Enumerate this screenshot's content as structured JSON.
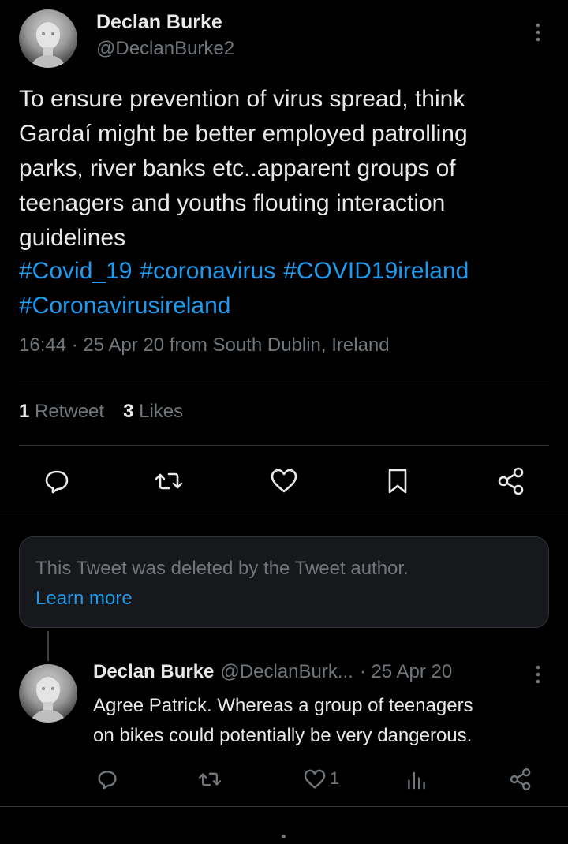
{
  "tweet": {
    "author_name": "Declan Burke",
    "author_handle": "@DeclanBurke2",
    "body_lines": [
      "To ensure prevention of  virus spread, think",
      "Gardaí might be better employed patrolling",
      "parks, river banks etc..apparent groups of",
      "teenagers and youths flouting interaction",
      "guidelines"
    ],
    "hashtags": [
      "#Covid_19",
      "#coronavirus",
      "#COVID19ireland",
      "#Coronavirusireland"
    ],
    "meta": "16:44 · 25 Apr 20 from South Dublin, Ireland",
    "retweet_count": "1",
    "retweet_label": "Retweet",
    "like_count": "3",
    "like_label": "Likes"
  },
  "deleted_notice": {
    "text": "This Tweet was deleted by the Tweet author.",
    "link": "Learn more"
  },
  "reply": {
    "author_name": "Declan Burke",
    "author_handle": "@DeclanBurk...",
    "date": "· 25 Apr 20",
    "body_lines": [
      "Agree Patrick. Whereas a group of teenagers",
      "on bikes could potentially be very dangerous."
    ],
    "like_count": "1"
  },
  "colors": {
    "background": "#000000",
    "text": "#e7e9ea",
    "muted": "#71767b",
    "link": "#1d9bf0",
    "divider": "#2f3336"
  },
  "icons": {
    "avatar": "statue-avatar",
    "more": "more-vertical-icon",
    "reply": "reply-icon",
    "retweet": "retweet-icon",
    "like": "heart-icon",
    "bookmark": "bookmark-icon",
    "share": "share-icon",
    "analytics": "analytics-icon"
  }
}
